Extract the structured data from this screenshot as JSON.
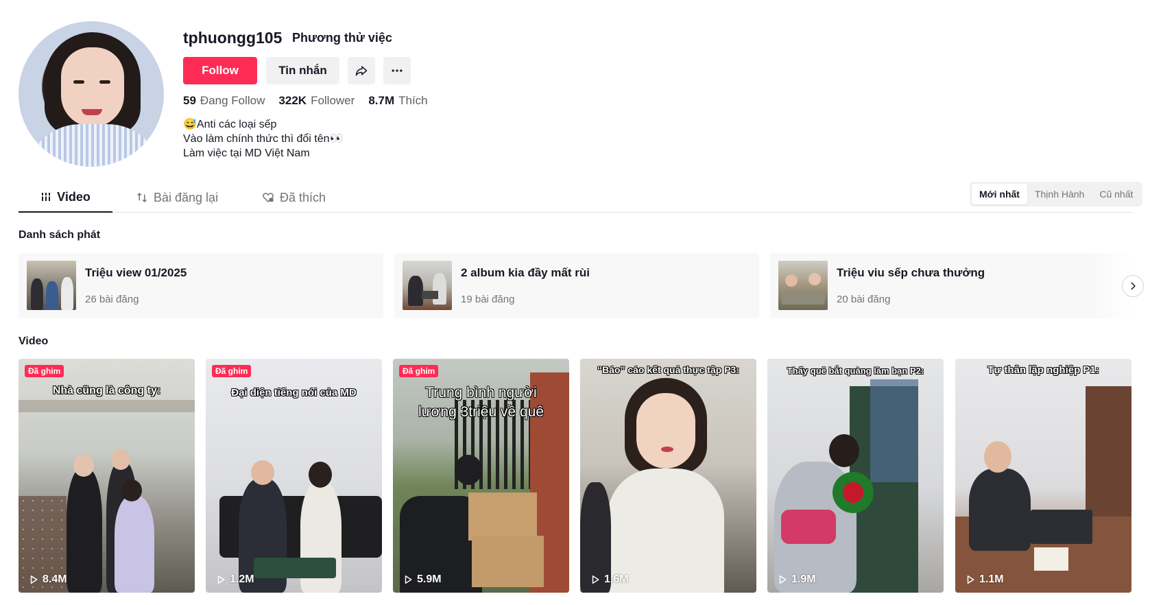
{
  "profile": {
    "username": "tphuongg105",
    "nickname": "Phương thử việc",
    "follow_label": "Follow",
    "message_label": "Tin nhắn",
    "share_icon": "share-icon",
    "more_icon": "more-icon",
    "stats": [
      {
        "value": "59",
        "label": "Đang Follow"
      },
      {
        "value": "322K",
        "label": "Follower"
      },
      {
        "value": "8.7M",
        "label": "Thích"
      }
    ],
    "bio": [
      "😅Anti các loại sếp",
      "Vào làm chính thức thì đổi tên👀",
      "Làm việc tại MD Việt Nam"
    ]
  },
  "tabs": {
    "video": "Video",
    "reposts": "Bài đăng lại",
    "liked": "Đã thích"
  },
  "sort": {
    "options": [
      "Mới nhất",
      "Thịnh Hành",
      "Cũ nhất"
    ],
    "selected": "Mới nhất"
  },
  "playlists_section": {
    "title": "Danh sách phát",
    "items": [
      {
        "name": "Triệu view 01/2025",
        "count": "26 bài đăng"
      },
      {
        "name": "2 album kia đầy mất rùi",
        "count": "19 bài đăng"
      },
      {
        "name": "Triệu viu sếp chưa thưởng",
        "count": "20 bài đăng"
      }
    ]
  },
  "videos_section": {
    "title": "Video",
    "pinned_label": "Đã ghim",
    "items": [
      {
        "caption": "Nhà cũng là công ty:",
        "views": "8.4M",
        "pinned": true
      },
      {
        "caption": "Đại diện tiếng nói của MD",
        "views": "1.2M",
        "pinned": true
      },
      {
        "caption": "Trung bình người lương 3triệu về quê",
        "views": "5.9M",
        "pinned": true
      },
      {
        "caption": "“Báo” cáo kết quả thực tập P3:",
        "views": "1.6M",
        "pinned": false
      },
      {
        "caption": "Thấy quê bắt quàng làm bạn P2:",
        "views": "1.9M",
        "pinned": false
      },
      {
        "caption": "Tự thân lập nghiệp P1:",
        "views": "1.1M",
        "pinned": false
      }
    ]
  },
  "colors": {
    "accent": "#fe2c55",
    "text": "#161823",
    "muted": "#73747b"
  }
}
